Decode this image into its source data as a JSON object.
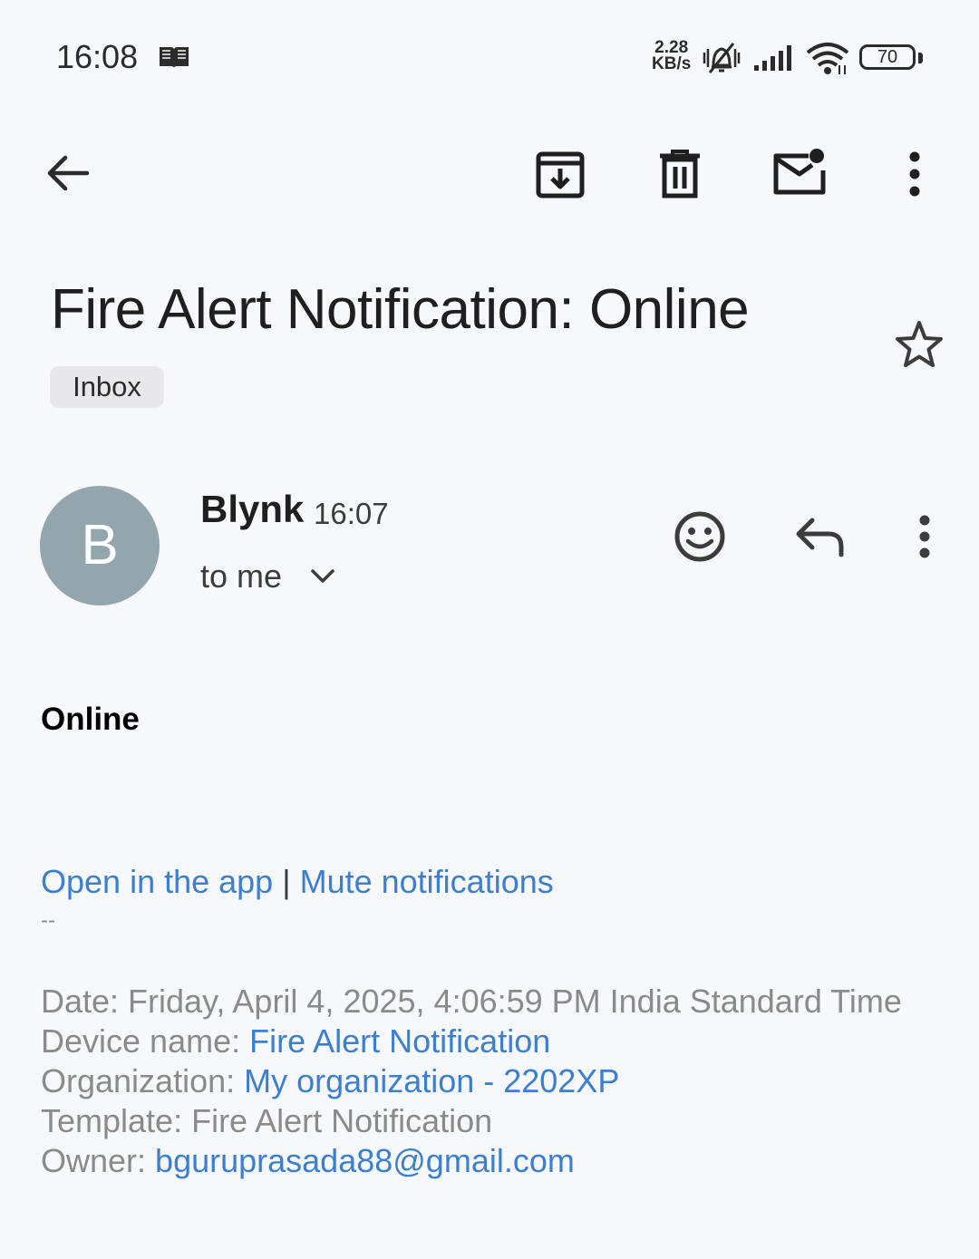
{
  "status_bar": {
    "time": "16:08",
    "net_speed_value": "2.28",
    "net_speed_unit": "KB/s",
    "battery": "70",
    "icons": [
      "book-icon",
      "silent-vibrate-icon",
      "signal-icon",
      "wifi-icon",
      "battery-icon"
    ]
  },
  "toolbar": {
    "icons": [
      "back-arrow-icon",
      "archive-icon",
      "delete-icon",
      "mark-unread-icon",
      "more-vert-icon"
    ]
  },
  "email": {
    "subject": "Fire Alert Notification: Online",
    "label_chip": "Inbox",
    "sender_initial": "B",
    "sender_name": "Blynk",
    "sent_time": "16:07",
    "recipient": "to me",
    "body_status": "Online",
    "links": {
      "open_app": "Open in the app",
      "separator": "|",
      "mute": "Mute notifications"
    },
    "dashes": "--",
    "details": {
      "date_label": "Date: ",
      "date_value": "Friday, April 4, 2025, 4:06:59 PM India Standard Time",
      "device_label": "Device name: ",
      "device_value": "Fire Alert Notification",
      "org_label": "Organization: ",
      "org_value": "My organization - 2202XP",
      "template_label": "Template: ",
      "template_value": "Fire Alert Notification",
      "owner_label": "Owner: ",
      "owner_value": "bguruprasada88@gmail.com"
    }
  },
  "colors": {
    "background": "#f7f8fc",
    "link": "#3b7fce",
    "avatar": "#93a5ad",
    "chip": "#e8e8ea",
    "muted_text": "#8a8a8a"
  }
}
